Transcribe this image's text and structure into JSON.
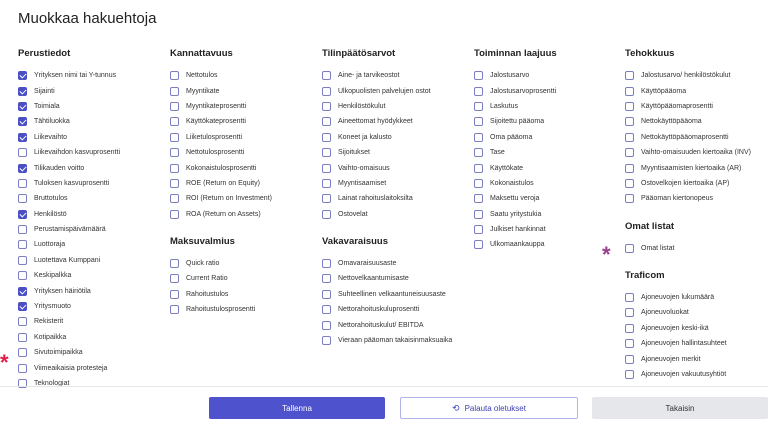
{
  "title": "Muokkaa hakuehtoja",
  "columns": [
    {
      "sections": [
        {
          "title": "Perustiedot",
          "items": [
            {
              "label": "Yrityksen nimi tai Y-tunnus",
              "checked": true
            },
            {
              "label": "Sijainti",
              "checked": true
            },
            {
              "label": "Toimiala",
              "checked": true
            },
            {
              "label": "Tähtiluokka",
              "checked": true
            },
            {
              "label": "Liikevaihto",
              "checked": true
            },
            {
              "label": "Liikevaihdon kasvuprosentti",
              "checked": false
            },
            {
              "label": "Tilikauden voitto",
              "checked": true
            },
            {
              "label": "Tuloksen kasvuprosentti",
              "checked": false
            },
            {
              "label": "Bruttotulos",
              "checked": false
            },
            {
              "label": "Henkilöstö",
              "checked": true
            },
            {
              "label": "Perustamispäivämäärä",
              "checked": false
            },
            {
              "label": "Luottoraja",
              "checked": false
            },
            {
              "label": "Luotettava Kumppani",
              "checked": false
            },
            {
              "label": "Keskipalkka",
              "checked": false
            },
            {
              "label": "Yrityksen häiriötila",
              "checked": true
            },
            {
              "label": "Yritysmuoto",
              "checked": true
            },
            {
              "label": "Rekisterit",
              "checked": false
            },
            {
              "label": "Kotipaikka",
              "checked": false
            },
            {
              "label": "Sivutoimipaikka",
              "checked": false
            },
            {
              "label": "Viimeaikaisia protesteja",
              "checked": false
            },
            {
              "label": "Teknologiat",
              "checked": false
            }
          ]
        }
      ]
    },
    {
      "sections": [
        {
          "title": "Kannattavuus",
          "items": [
            {
              "label": "Nettotulos",
              "checked": false
            },
            {
              "label": "Myyntikate",
              "checked": false
            },
            {
              "label": "Myyntikateprosentti",
              "checked": false
            },
            {
              "label": "Käyttökateprosentti",
              "checked": false
            },
            {
              "label": "Liiketulosprosentti",
              "checked": false
            },
            {
              "label": "Nettotulosprosentti",
              "checked": false
            },
            {
              "label": "Kokonaistulosprosentti",
              "checked": false
            },
            {
              "label": "ROE (Return on Equity)",
              "checked": false
            },
            {
              "label": "ROI (Return on Investment)",
              "checked": false
            },
            {
              "label": "ROA (Return on Assets)",
              "checked": false
            }
          ]
        },
        {
          "title": "Maksuvalmius",
          "items": [
            {
              "label": "Quick ratio",
              "checked": false
            },
            {
              "label": "Current Ratio",
              "checked": false
            },
            {
              "label": "Rahoitustulos",
              "checked": false
            },
            {
              "label": "Rahoitustulosprosentti",
              "checked": false
            }
          ]
        }
      ]
    },
    {
      "sections": [
        {
          "title": "Tilinpäätösarvot",
          "items": [
            {
              "label": "Aine- ja tarvikeostot",
              "checked": false
            },
            {
              "label": "Ulkopuolisten palvelujen ostot",
              "checked": false
            },
            {
              "label": "Henkilöstökulut",
              "checked": false
            },
            {
              "label": "Aineettomat hyödykkeet",
              "checked": false
            },
            {
              "label": "Koneet ja kalusto",
              "checked": false
            },
            {
              "label": "Sijoitukset",
              "checked": false
            },
            {
              "label": "Vaihto-omaisuus",
              "checked": false
            },
            {
              "label": "Myyntisaamiset",
              "checked": false
            },
            {
              "label": "Lainat rahoituslaitoksilta",
              "checked": false
            },
            {
              "label": "Ostovelat",
              "checked": false
            }
          ]
        },
        {
          "title": "Vakavaraisuus",
          "items": [
            {
              "label": "Omavaraisuusaste",
              "checked": false
            },
            {
              "label": "Nettovelkaantumisaste",
              "checked": false
            },
            {
              "label": "Suhteellinen velkaantuneisuusaste",
              "checked": false
            },
            {
              "label": "Nettorahoituskuluprosentti",
              "checked": false
            },
            {
              "label": "Nettorahoituskulut/ EBITDA",
              "checked": false
            },
            {
              "label": "Vieraan pääoman takaisinmaksuaika",
              "checked": false
            }
          ]
        }
      ]
    },
    {
      "sections": [
        {
          "title": "Toiminnan laajuus",
          "items": [
            {
              "label": "Jalostusarvo",
              "checked": false
            },
            {
              "label": "Jalostusarvoprosentti",
              "checked": false
            },
            {
              "label": "Laskutus",
              "checked": false
            },
            {
              "label": "Sijoitettu pääoma",
              "checked": false
            },
            {
              "label": "Oma pääoma",
              "checked": false
            },
            {
              "label": "Tase",
              "checked": false
            },
            {
              "label": "Käyttökate",
              "checked": false
            },
            {
              "label": "Kokonaistulos",
              "checked": false
            },
            {
              "label": "Maksettu veroja",
              "checked": false
            },
            {
              "label": "Saatu yritystukia",
              "checked": false
            },
            {
              "label": "Julkiset hankinnat",
              "checked": false
            },
            {
              "label": "Ulkomaankauppa",
              "checked": false
            }
          ]
        }
      ]
    },
    {
      "sections": [
        {
          "title": "Tehokkuus",
          "items": [
            {
              "label": "Jalostusarvo/ henkilöstökulut",
              "checked": false
            },
            {
              "label": "Käyttöpääoma",
              "checked": false
            },
            {
              "label": "Käyttöpääomaprosentti",
              "checked": false
            },
            {
              "label": "Nettokäyttöpääoma",
              "checked": false
            },
            {
              "label": "Nettokäyttöpääomaprosentti",
              "checked": false
            },
            {
              "label": "Vaihto-omaisuuden kiertoaika (INV)",
              "checked": false
            },
            {
              "label": "Myyntisaamisten kiertoaika (AR)",
              "checked": false
            },
            {
              "label": "Ostovelkojen kiertoaika (AP)",
              "checked": false
            },
            {
              "label": "Pääoman kiertonopeus",
              "checked": false
            }
          ]
        },
        {
          "title": "Omat listat",
          "items": [
            {
              "label": "Omat listat",
              "checked": false
            }
          ]
        },
        {
          "title": "Traficom",
          "items": [
            {
              "label": "Ajoneuvojen lukumäärä",
              "checked": false
            },
            {
              "label": "Ajoneuvoluokat",
              "checked": false
            },
            {
              "label": "Ajoneuvojen keski-ikä",
              "checked": false
            },
            {
              "label": "Ajoneuvojen hallintasuhteet",
              "checked": false
            },
            {
              "label": "Ajoneuvojen merkit",
              "checked": false
            },
            {
              "label": "Ajoneuvojen vakuutusyhtiöt",
              "checked": false
            }
          ]
        }
      ]
    }
  ],
  "buttons": {
    "save": "Tallenna",
    "reset": "Palauta oletukset",
    "back": "Takaisin"
  },
  "markers": {
    "red_star": "*",
    "purple_star": "*"
  },
  "colors": {
    "accent": "#4e52cc",
    "checkbox_checked": "#4a4fc4",
    "star_red": "#e11d48",
    "star_purple": "#9b3e8f"
  },
  "icons": {
    "reset": "refresh-icon"
  }
}
